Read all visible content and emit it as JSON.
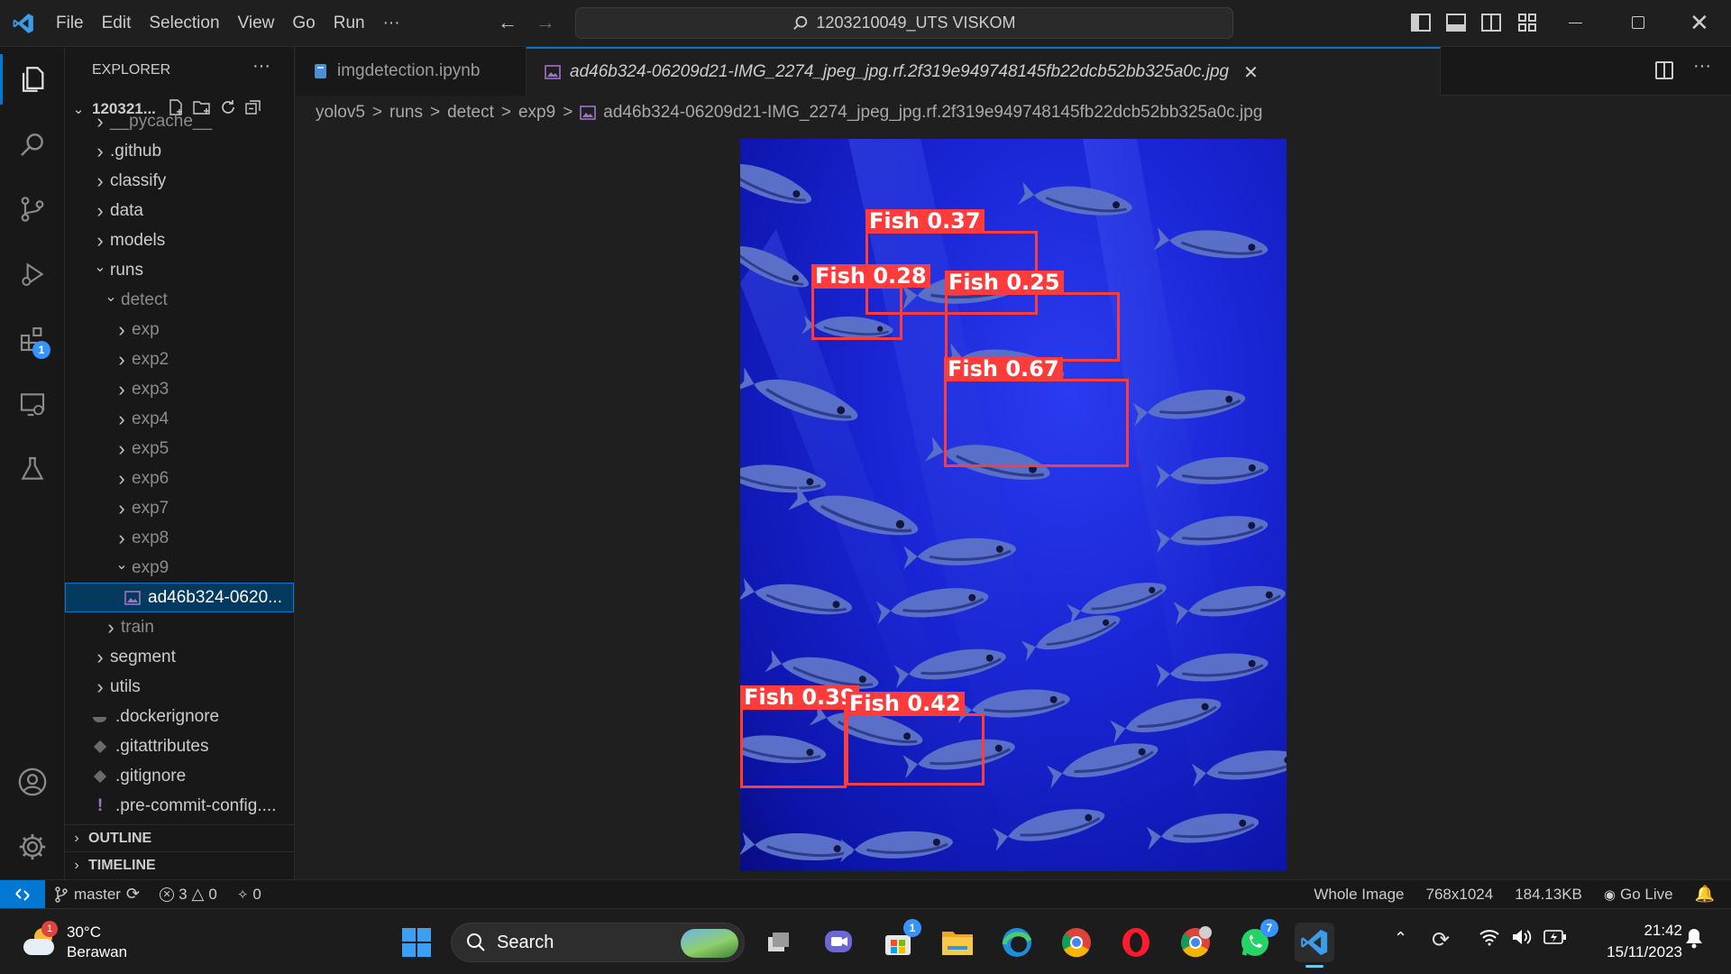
{
  "titlebar": {
    "menu": [
      "File",
      "Edit",
      "Selection",
      "View",
      "Go",
      "Run",
      "···"
    ],
    "search_text": "1203210049_UTS VISKOM"
  },
  "sidebar": {
    "header": "EXPLORER",
    "root": "120321...",
    "items": [
      {
        "label": "__pycache__",
        "indent": 0,
        "chevron": ">",
        "type": "folder",
        "dim": true
      },
      {
        "label": ".github",
        "indent": 0,
        "chevron": ">",
        "type": "folder"
      },
      {
        "label": "classify",
        "indent": 0,
        "chevron": ">",
        "type": "folder"
      },
      {
        "label": "data",
        "indent": 0,
        "chevron": ">",
        "type": "folder"
      },
      {
        "label": "models",
        "indent": 0,
        "chevron": ">",
        "type": "folder"
      },
      {
        "label": "runs",
        "indent": 0,
        "chevron": "v",
        "type": "folder"
      },
      {
        "label": "detect",
        "indent": 1,
        "chevron": "v",
        "type": "folder",
        "dim": true
      },
      {
        "label": "exp",
        "indent": 2,
        "chevron": ">",
        "type": "folder",
        "dim": true
      },
      {
        "label": "exp2",
        "indent": 2,
        "chevron": ">",
        "type": "folder",
        "dim": true
      },
      {
        "label": "exp3",
        "indent": 2,
        "chevron": ">",
        "type": "folder",
        "dim": true
      },
      {
        "label": "exp4",
        "indent": 2,
        "chevron": ">",
        "type": "folder",
        "dim": true
      },
      {
        "label": "exp5",
        "indent": 2,
        "chevron": ">",
        "type": "folder",
        "dim": true
      },
      {
        "label": "exp6",
        "indent": 2,
        "chevron": ">",
        "type": "folder",
        "dim": true
      },
      {
        "label": "exp7",
        "indent": 2,
        "chevron": ">",
        "type": "folder",
        "dim": true
      },
      {
        "label": "exp8",
        "indent": 2,
        "chevron": ">",
        "type": "folder",
        "dim": true
      },
      {
        "label": "exp9",
        "indent": 2,
        "chevron": "v",
        "type": "folder",
        "dim": true
      },
      {
        "label": "ad46b324-0620...",
        "indent": 3,
        "chevron": "",
        "type": "image",
        "selected": true
      },
      {
        "label": "train",
        "indent": 1,
        "chevron": ">",
        "type": "folder",
        "dim": true
      },
      {
        "label": "segment",
        "indent": 0,
        "chevron": ">",
        "type": "folder"
      },
      {
        "label": "utils",
        "indent": 0,
        "chevron": ">",
        "type": "folder"
      },
      {
        "label": ".dockerignore",
        "indent": 0,
        "chevron": "",
        "type": "docker"
      },
      {
        "label": ".gitattributes",
        "indent": 0,
        "chevron": "",
        "type": "git"
      },
      {
        "label": ".gitignore",
        "indent": 0,
        "chevron": "",
        "type": "git"
      },
      {
        "label": ".pre-commit-config....",
        "indent": 0,
        "chevron": "",
        "type": "yaml"
      }
    ],
    "outline": "OUTLINE",
    "timeline": "TIMELINE"
  },
  "tabs": [
    {
      "label": "imgdetection.ipynb",
      "active": false
    },
    {
      "label": "ad46b324-06209d21-IMG_2274_jpeg_jpg.rf.2f319e949748145fb22dcb52bb325a0c.jpg",
      "active": true
    }
  ],
  "breadcrumb": [
    "yolov5",
    "runs",
    "detect",
    "exp9",
    "ad46b324-06209d21-IMG_2274_jpeg_jpg.rf.2f319e949748145fb22dcb52bb325a0c.jpg"
  ],
  "detections": [
    {
      "label": "Fish 0.37"
    },
    {
      "label": "Fish 0.28"
    },
    {
      "label": "Fish 0.25"
    },
    {
      "label": "Fish 0.67"
    },
    {
      "label": "Fish 0.39"
    },
    {
      "label": "Fish 0.42"
    }
  ],
  "statusbar": {
    "branch": "master",
    "errors": "3",
    "warnings": "0",
    "ports": "0",
    "zoom_mode": "Whole Image",
    "dimensions": "768x1024",
    "file_size": "184.13KB",
    "go_live": "Go Live"
  },
  "activity_badge": "1",
  "taskbar": {
    "weather_temp": "30°C",
    "weather_desc": "Berawan",
    "weather_badge": "1",
    "search": "Search",
    "time": "21:42",
    "date": "15/11/2023",
    "store_badge": "1",
    "whatsapp_badge": "7"
  },
  "colors": {
    "accent": "#0078d4",
    "detection": "#ff3b3b",
    "selection_bg": "#04395e"
  }
}
